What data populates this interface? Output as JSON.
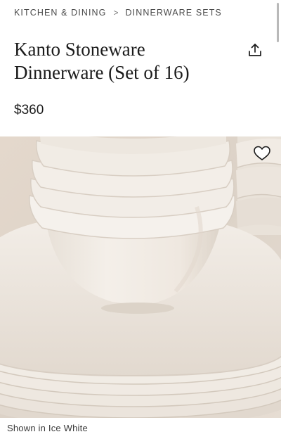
{
  "breadcrumb": {
    "items": [
      "KITCHEN & DINING",
      "DINNERWARE SETS"
    ],
    "separator": ">"
  },
  "product": {
    "title": "Kanto Stoneware Dinnerware (Set of 16)",
    "price": "$360",
    "color_caption": "Shown in Ice White"
  },
  "icons": {
    "share": "share-icon",
    "favorite": "heart-icon"
  },
  "image": {
    "alt": "Stacked Kanto stoneware bowls and plates in Ice White"
  },
  "colors": {
    "background": "#ffffff",
    "text": "#1b1b1b",
    "muted": "#4a4a4a",
    "stoneware": "#efe9e1"
  }
}
